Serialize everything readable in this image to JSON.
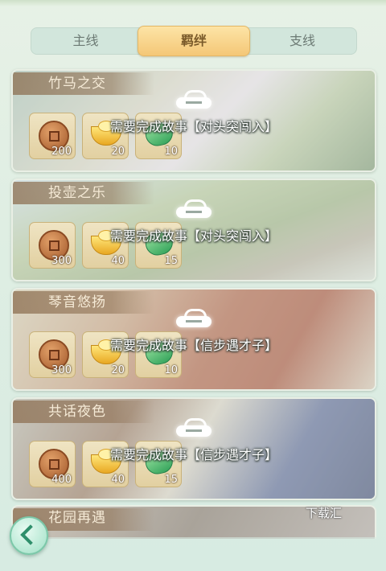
{
  "tabs": [
    {
      "label": "主线",
      "active": false
    },
    {
      "label": "羁绊",
      "active": true
    },
    {
      "label": "支线",
      "active": false
    }
  ],
  "cards": [
    {
      "title": "竹马之交",
      "requirement": "需要完成故事【对头突闯入】",
      "rewards": [
        {
          "icon": "copper-coin-icon",
          "qty": "200"
        },
        {
          "icon": "gold-ingot-icon",
          "qty": "20"
        },
        {
          "icon": "jade-icon",
          "qty": "10"
        }
      ]
    },
    {
      "title": "投壶之乐",
      "requirement": "需要完成故事【对头突闯入】",
      "rewards": [
        {
          "icon": "copper-coin-icon",
          "qty": "300"
        },
        {
          "icon": "gold-ingot-icon",
          "qty": "40"
        },
        {
          "icon": "jade-icon",
          "qty": "15"
        }
      ]
    },
    {
      "title": "琴音悠扬",
      "requirement": "需要完成故事【信步遇才子】",
      "rewards": [
        {
          "icon": "copper-coin-icon",
          "qty": "300"
        },
        {
          "icon": "gold-ingot-icon",
          "qty": "20"
        },
        {
          "icon": "jade-icon",
          "qty": "10"
        }
      ]
    },
    {
      "title": "共话夜色",
      "requirement": "需要完成故事【信步遇才子】",
      "rewards": [
        {
          "icon": "copper-coin-icon",
          "qty": "400"
        },
        {
          "icon": "gold-ingot-icon",
          "qty": "40"
        },
        {
          "icon": "jade-icon",
          "qty": "15"
        }
      ]
    }
  ],
  "partial_card": {
    "title": "花园再遇"
  },
  "watermark": "下载汇",
  "colors": {
    "accent_tab": "#f4c777",
    "background": "#e7f1e6"
  }
}
